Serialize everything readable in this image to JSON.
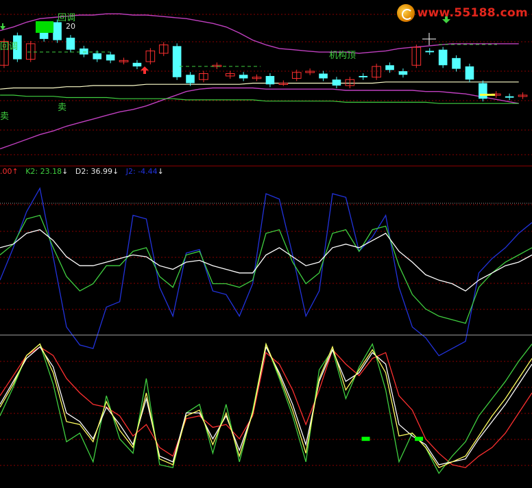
{
  "watermark": {
    "text": "www.55188.com"
  },
  "legend": {
    "items": [
      {
        "text": ".00",
        "color": "#ff3030",
        "arrow": "↑",
        "arrow_color": "#ff3030"
      },
      {
        "text": "K2: 23.18",
        "color": "#e8e8e8",
        "arrow": "↓",
        "arrow_color": "#e8e8e8"
      },
      {
        "text": "D2: 36.99",
        "color": "#e8e8e8",
        "arrow": "↓",
        "arrow_color": "#e8e8e8"
      },
      {
        "text": "J2: -4.44",
        "color": "#2233dd",
        "arrow": "↓",
        "arrow_color": "#e8e8e8"
      }
    ]
  },
  "annotations": {
    "huitiao_1": "回调",
    "huitiao_2": "回调",
    "value_20": "20",
    "jigouding": "机构顶",
    "mai_1": "卖",
    "mai_2": "卖"
  },
  "colors": {
    "up_candle": "#ff3030",
    "down_candle": "#54ffff",
    "boll_upper": "#c040c0",
    "boll_mid_white": "#ffffcc",
    "long_line": "#40d040",
    "grid": "#8b0000",
    "j_line": "#2233dd",
    "k_line": "#40d040",
    "d_line": "#ffffff",
    "r_line": "#ff3030",
    "y_line": "#ffff60"
  },
  "chart_data": [
    {
      "type": "candlestick",
      "panel": "price",
      "candles": [
        {
          "o": 5.0,
          "c": 7.0
        },
        {
          "o": 7.5,
          "c": 5.5
        },
        {
          "o": 5.5,
          "c": 6.8
        },
        {
          "o": 7.8,
          "c": 7.2
        },
        {
          "o": 8.6,
          "c": 7.1
        },
        {
          "o": 7.3,
          "c": 6.3
        },
        {
          "o": 6.4,
          "c": 5.9
        },
        {
          "o": 6.0,
          "c": 5.5
        },
        {
          "o": 5.9,
          "c": 5.4
        },
        {
          "o": 5.3,
          "c": 5.4
        },
        {
          "o": 5.2,
          "c": 4.9
        },
        {
          "o": 5.3,
          "c": 6.2
        },
        {
          "o": 6.0,
          "c": 6.7
        },
        {
          "o": 6.6,
          "c": 4.0
        },
        {
          "o": 4.2,
          "c": 3.5
        },
        {
          "o": 3.8,
          "c": 4.3
        },
        {
          "o": 4.9,
          "c": 5.0
        },
        {
          "o": 4.1,
          "c": 4.3
        },
        {
          "o": 4.2,
          "c": 3.9
        },
        {
          "o": 3.9,
          "c": 4.0
        },
        {
          "o": 4.1,
          "c": 3.4
        },
        {
          "o": 3.5,
          "c": 3.5
        },
        {
          "o": 3.9,
          "c": 4.4
        },
        {
          "o": 4.4,
          "c": 4.5
        },
        {
          "o": 4.3,
          "c": 3.9
        },
        {
          "o": 3.8,
          "c": 3.3
        },
        {
          "o": 3.3,
          "c": 3.8
        },
        {
          "o": 4.1,
          "c": 4.0
        },
        {
          "o": 4.0,
          "c": 4.9
        },
        {
          "o": 5.0,
          "c": 4.6
        },
        {
          "o": 4.5,
          "c": 4.2
        },
        {
          "o": 5.0,
          "c": 6.5
        },
        {
          "o": 6.2,
          "c": 6.1
        },
        {
          "o": 6.3,
          "c": 5.0
        },
        {
          "o": 5.6,
          "c": 4.7
        },
        {
          "o": 4.9,
          "c": 3.8
        },
        {
          "o": 3.5,
          "c": 2.2
        },
        {
          "o": 2.5,
          "c": 2.6
        },
        {
          "o": 2.4,
          "c": 2.3
        },
        {
          "o": 2.4,
          "c": 2.5
        }
      ],
      "boll_upper": [
        7.9,
        8.2,
        8.6,
        8.9,
        9.0,
        9.1,
        9.2,
        9.2,
        9.3,
        9.3,
        9.2,
        9.2,
        9.1,
        9.0,
        8.9,
        8.7,
        8.5,
        8.2,
        7.7,
        7.1,
        6.7,
        6.4,
        6.3,
        6.2,
        6.1,
        6.1,
        6.1,
        6.0,
        6.1,
        6.2,
        6.4,
        6.5,
        6.6,
        6.7,
        6.8,
        6.8,
        6.8,
        6.8,
        6.8,
        6.8
      ],
      "boll_lower": [
        -2.0,
        -1.6,
        -1.2,
        -0.8,
        -0.5,
        -0.1,
        0.2,
        0.5,
        0.8,
        1.1,
        1.3,
        1.6,
        2.0,
        2.4,
        2.8,
        3.0,
        3.1,
        3.1,
        3.1,
        3.1,
        3.0,
        3.0,
        3.0,
        3.0,
        3.0,
        3.0,
        2.9,
        2.9,
        2.9,
        2.9,
        2.9,
        2.9,
        2.8,
        2.8,
        2.7,
        2.6,
        2.4,
        2.2,
        2.0,
        1.8
      ],
      "mid_line": [
        3.0,
        3.1,
        3.1,
        3.1,
        3.1,
        3.2,
        3.2,
        3.3,
        3.3,
        3.3,
        3.3,
        3.4,
        3.4,
        3.4,
        3.4,
        3.4,
        3.4,
        3.4,
        3.4,
        3.5,
        3.5,
        3.5,
        3.5,
        3.5,
        3.5,
        3.5,
        3.5,
        3.5,
        3.5,
        3.6,
        3.6,
        3.6,
        3.6,
        3.6,
        3.6,
        3.6,
        3.6,
        3.6,
        3.6,
        3.6
      ],
      "long_line": [
        2.5,
        2.5,
        2.4,
        2.4,
        2.4,
        2.3,
        2.3,
        2.3,
        2.3,
        2.2,
        2.2,
        2.2,
        2.2,
        2.2,
        2.1,
        2.1,
        2.1,
        2.1,
        2.1,
        2.1,
        2.0,
        2.0,
        2.0,
        2.0,
        2.0,
        2.0,
        1.9,
        1.9,
        1.9,
        1.9,
        1.9,
        1.9,
        1.9,
        1.8,
        1.8,
        1.8,
        1.8,
        1.8,
        1.8,
        1.8
      ],
      "ylim": [
        -3,
        10
      ]
    },
    {
      "type": "line",
      "panel": "kdj",
      "x": [
        0,
        1,
        2,
        3,
        4,
        5,
        6,
        7,
        8,
        9,
        10,
        11,
        12,
        13,
        14,
        15,
        16,
        17,
        18,
        19,
        20,
        21,
        22,
        23,
        24,
        25,
        26,
        27,
        28,
        29,
        30,
        31,
        32,
        33,
        34,
        35,
        36,
        37,
        38,
        39,
        40
      ],
      "series": [
        {
          "name": "J2",
          "color": "#2233dd",
          "values": [
            44,
            62,
            82,
            95,
            57,
            18,
            8,
            6,
            29,
            32,
            80,
            78,
            40,
            24,
            59,
            61,
            38,
            36,
            24,
            42,
            92,
            89,
            58,
            24,
            38,
            92,
            90,
            60,
            68,
            80,
            40,
            18,
            12,
            2,
            6,
            10,
            48,
            56,
            62,
            70,
            76
          ]
        },
        {
          "name": "K2",
          "color": "#40d040",
          "values": [
            58,
            64,
            78,
            80,
            62,
            46,
            38,
            42,
            52,
            52,
            60,
            62,
            46,
            40,
            58,
            60,
            42,
            42,
            40,
            44,
            70,
            72,
            54,
            42,
            48,
            70,
            72,
            60,
            72,
            74,
            52,
            36,
            28,
            24,
            22,
            20,
            40,
            48,
            54,
            58,
            62
          ]
        },
        {
          "name": "D2",
          "color": "#ffffff",
          "values": [
            62,
            64,
            70,
            72,
            66,
            57,
            52,
            52,
            54,
            56,
            58,
            57,
            52,
            50,
            54,
            55,
            52,
            50,
            48,
            48,
            58,
            62,
            57,
            52,
            54,
            62,
            64,
            62,
            66,
            70,
            60,
            54,
            47,
            44,
            42,
            38,
            44,
            48,
            52,
            54,
            58
          ]
        }
      ],
      "ylim": [
        0,
        100
      ]
    },
    {
      "type": "line",
      "panel": "lower",
      "x": [
        0,
        1,
        2,
        3,
        4,
        5,
        6,
        7,
        8,
        9,
        10,
        11,
        12,
        13,
        14,
        15,
        16,
        17,
        18,
        19,
        20,
        21,
        22,
        23,
        24,
        25,
        26,
        27,
        28,
        29,
        30,
        31,
        32,
        33,
        34,
        35,
        36,
        37,
        38,
        39,
        40
      ],
      "series": [
        {
          "color": "#ff3030",
          "values": [
            58,
            72,
            86,
            92,
            86,
            70,
            60,
            52,
            50,
            44,
            30,
            38,
            22,
            16,
            42,
            44,
            36,
            38,
            28,
            44,
            88,
            80,
            62,
            38,
            62,
            90,
            80,
            72,
            84,
            88,
            58,
            48,
            28,
            18,
            10,
            8,
            16,
            22,
            32,
            46,
            60
          ]
        },
        {
          "color": "#40d040",
          "values": [
            44,
            64,
            86,
            94,
            66,
            26,
            32,
            12,
            58,
            28,
            18,
            70,
            10,
            8,
            46,
            52,
            18,
            52,
            12,
            48,
            94,
            70,
            44,
            12,
            76,
            90,
            56,
            78,
            94,
            62,
            12,
            32,
            22,
            4,
            16,
            26,
            44,
            56,
            68,
            82,
            94
          ]
        },
        {
          "color": "#ffffff",
          "values": [
            52,
            68,
            84,
            92,
            78,
            46,
            40,
            28,
            50,
            38,
            24,
            56,
            16,
            12,
            46,
            46,
            28,
            44,
            20,
            46,
            92,
            74,
            52,
            24,
            68,
            90,
            68,
            74,
            88,
            80,
            38,
            30,
            24,
            10,
            12,
            14,
            28,
            40,
            52,
            66,
            80
          ]
        },
        {
          "color": "#ffff60",
          "values": [
            50,
            66,
            86,
            94,
            74,
            40,
            38,
            26,
            54,
            34,
            22,
            60,
            14,
            10,
            44,
            48,
            24,
            46,
            16,
            46,
            94,
            72,
            48,
            18,
            70,
            92,
            62,
            76,
            90,
            74,
            30,
            32,
            22,
            8,
            12,
            16,
            30,
            44,
            56,
            70,
            84
          ]
        }
      ],
      "markers": [
        {
          "x": 27.5,
          "y": 28,
          "color": "#00ff00"
        },
        {
          "x": 31.5,
          "y": 28,
          "color": "#00ff00"
        }
      ],
      "ylim": [
        0,
        100
      ]
    }
  ]
}
